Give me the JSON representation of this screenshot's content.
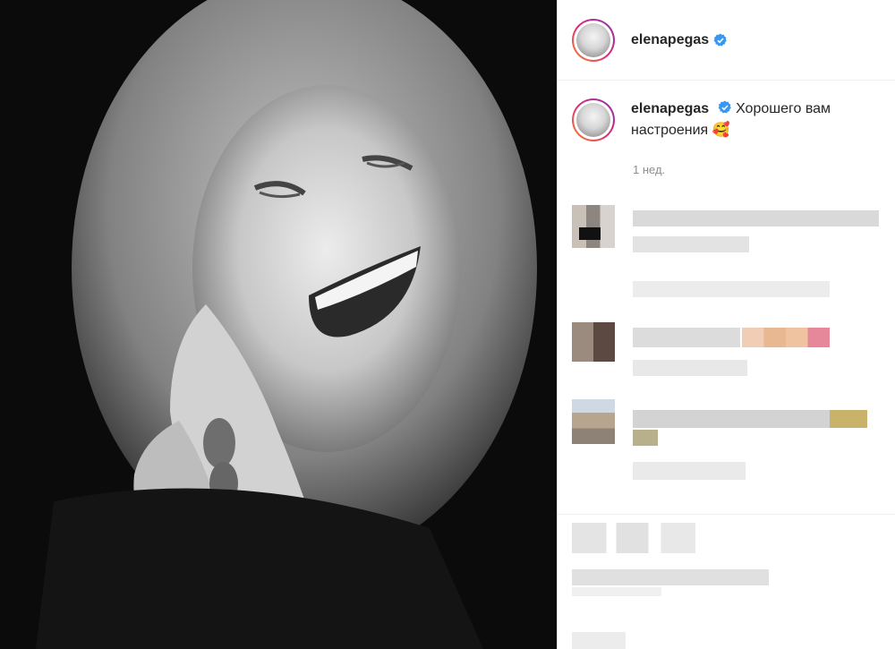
{
  "post": {
    "username": "elenapegas",
    "caption_text": "Хорошего вам настроения 🥰",
    "time": "1 нед."
  },
  "colors": {
    "verified": "#3897f0",
    "avatar_ring": "#dd2a7b",
    "muted": "#8e8e8e"
  },
  "icons": [
    "verified-badge-icon"
  ]
}
